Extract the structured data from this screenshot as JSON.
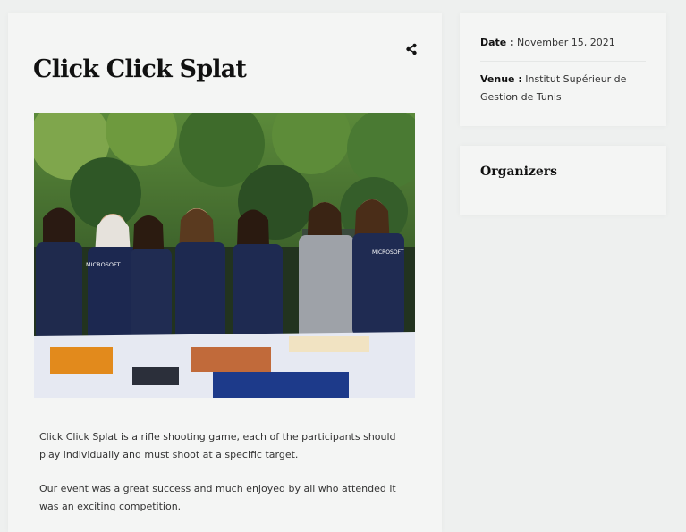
{
  "event": {
    "title": "Click Click Splat",
    "description": [
      "Click Click Splat is a rifle shooting game, each of the participants should play individually and must shoot at a specific target.",
      "Our event was a great success and much enjoyed by all who attended it was an exciting competition."
    ],
    "photo": {
      "shirt_text": "MICROSOFT"
    }
  },
  "details": {
    "date_label": "Date :",
    "date_value": "November 15, 2021",
    "venue_label": "Venue :",
    "venue_value": "Institut Supérieur de Gestion de Tunis"
  },
  "organizers": {
    "title": "Organizers"
  },
  "icons": {
    "share": "share-icon"
  }
}
